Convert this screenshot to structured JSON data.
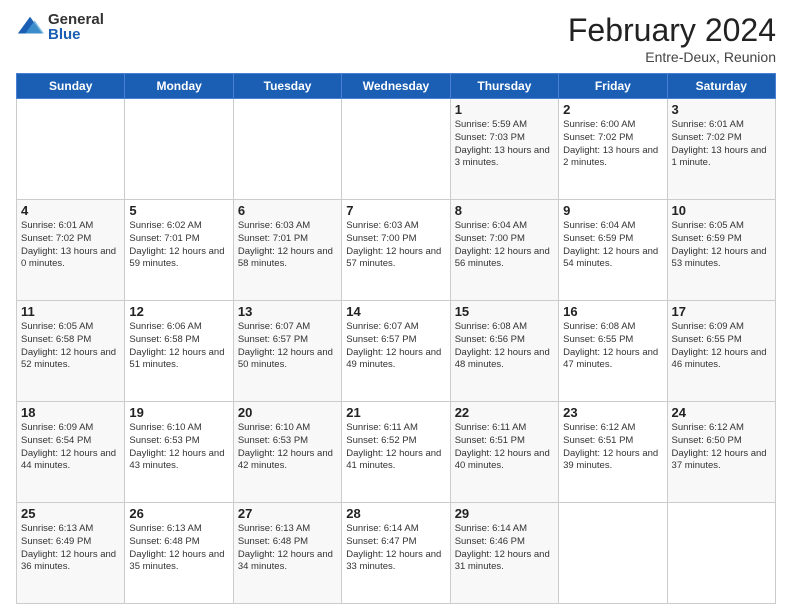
{
  "header": {
    "logo": {
      "general": "General",
      "blue": "Blue"
    },
    "title": "February 2024",
    "subtitle": "Entre-Deux, Reunion"
  },
  "calendar": {
    "days": [
      "Sunday",
      "Monday",
      "Tuesday",
      "Wednesday",
      "Thursday",
      "Friday",
      "Saturday"
    ],
    "weeks": [
      [
        {
          "day": "",
          "sunrise": "",
          "sunset": "",
          "daylight": ""
        },
        {
          "day": "",
          "sunrise": "",
          "sunset": "",
          "daylight": ""
        },
        {
          "day": "",
          "sunrise": "",
          "sunset": "",
          "daylight": ""
        },
        {
          "day": "",
          "sunrise": "",
          "sunset": "",
          "daylight": ""
        },
        {
          "day": "1",
          "sunrise": "Sunrise: 5:59 AM",
          "sunset": "Sunset: 7:03 PM",
          "daylight": "Daylight: 13 hours and 3 minutes."
        },
        {
          "day": "2",
          "sunrise": "Sunrise: 6:00 AM",
          "sunset": "Sunset: 7:02 PM",
          "daylight": "Daylight: 13 hours and 2 minutes."
        },
        {
          "day": "3",
          "sunrise": "Sunrise: 6:01 AM",
          "sunset": "Sunset: 7:02 PM",
          "daylight": "Daylight: 13 hours and 1 minute."
        }
      ],
      [
        {
          "day": "4",
          "sunrise": "Sunrise: 6:01 AM",
          "sunset": "Sunset: 7:02 PM",
          "daylight": "Daylight: 13 hours and 0 minutes."
        },
        {
          "day": "5",
          "sunrise": "Sunrise: 6:02 AM",
          "sunset": "Sunset: 7:01 PM",
          "daylight": "Daylight: 12 hours and 59 minutes."
        },
        {
          "day": "6",
          "sunrise": "Sunrise: 6:03 AM",
          "sunset": "Sunset: 7:01 PM",
          "daylight": "Daylight: 12 hours and 58 minutes."
        },
        {
          "day": "7",
          "sunrise": "Sunrise: 6:03 AM",
          "sunset": "Sunset: 7:00 PM",
          "daylight": "Daylight: 12 hours and 57 minutes."
        },
        {
          "day": "8",
          "sunrise": "Sunrise: 6:04 AM",
          "sunset": "Sunset: 7:00 PM",
          "daylight": "Daylight: 12 hours and 56 minutes."
        },
        {
          "day": "9",
          "sunrise": "Sunrise: 6:04 AM",
          "sunset": "Sunset: 6:59 PM",
          "daylight": "Daylight: 12 hours and 54 minutes."
        },
        {
          "day": "10",
          "sunrise": "Sunrise: 6:05 AM",
          "sunset": "Sunset: 6:59 PM",
          "daylight": "Daylight: 12 hours and 53 minutes."
        }
      ],
      [
        {
          "day": "11",
          "sunrise": "Sunrise: 6:05 AM",
          "sunset": "Sunset: 6:58 PM",
          "daylight": "Daylight: 12 hours and 52 minutes."
        },
        {
          "day": "12",
          "sunrise": "Sunrise: 6:06 AM",
          "sunset": "Sunset: 6:58 PM",
          "daylight": "Daylight: 12 hours and 51 minutes."
        },
        {
          "day": "13",
          "sunrise": "Sunrise: 6:07 AM",
          "sunset": "Sunset: 6:57 PM",
          "daylight": "Daylight: 12 hours and 50 minutes."
        },
        {
          "day": "14",
          "sunrise": "Sunrise: 6:07 AM",
          "sunset": "Sunset: 6:57 PM",
          "daylight": "Daylight: 12 hours and 49 minutes."
        },
        {
          "day": "15",
          "sunrise": "Sunrise: 6:08 AM",
          "sunset": "Sunset: 6:56 PM",
          "daylight": "Daylight: 12 hours and 48 minutes."
        },
        {
          "day": "16",
          "sunrise": "Sunrise: 6:08 AM",
          "sunset": "Sunset: 6:55 PM",
          "daylight": "Daylight: 12 hours and 47 minutes."
        },
        {
          "day": "17",
          "sunrise": "Sunrise: 6:09 AM",
          "sunset": "Sunset: 6:55 PM",
          "daylight": "Daylight: 12 hours and 46 minutes."
        }
      ],
      [
        {
          "day": "18",
          "sunrise": "Sunrise: 6:09 AM",
          "sunset": "Sunset: 6:54 PM",
          "daylight": "Daylight: 12 hours and 44 minutes."
        },
        {
          "day": "19",
          "sunrise": "Sunrise: 6:10 AM",
          "sunset": "Sunset: 6:53 PM",
          "daylight": "Daylight: 12 hours and 43 minutes."
        },
        {
          "day": "20",
          "sunrise": "Sunrise: 6:10 AM",
          "sunset": "Sunset: 6:53 PM",
          "daylight": "Daylight: 12 hours and 42 minutes."
        },
        {
          "day": "21",
          "sunrise": "Sunrise: 6:11 AM",
          "sunset": "Sunset: 6:52 PM",
          "daylight": "Daylight: 12 hours and 41 minutes."
        },
        {
          "day": "22",
          "sunrise": "Sunrise: 6:11 AM",
          "sunset": "Sunset: 6:51 PM",
          "daylight": "Daylight: 12 hours and 40 minutes."
        },
        {
          "day": "23",
          "sunrise": "Sunrise: 6:12 AM",
          "sunset": "Sunset: 6:51 PM",
          "daylight": "Daylight: 12 hours and 39 minutes."
        },
        {
          "day": "24",
          "sunrise": "Sunrise: 6:12 AM",
          "sunset": "Sunset: 6:50 PM",
          "daylight": "Daylight: 12 hours and 37 minutes."
        }
      ],
      [
        {
          "day": "25",
          "sunrise": "Sunrise: 6:13 AM",
          "sunset": "Sunset: 6:49 PM",
          "daylight": "Daylight: 12 hours and 36 minutes."
        },
        {
          "day": "26",
          "sunrise": "Sunrise: 6:13 AM",
          "sunset": "Sunset: 6:48 PM",
          "daylight": "Daylight: 12 hours and 35 minutes."
        },
        {
          "day": "27",
          "sunrise": "Sunrise: 6:13 AM",
          "sunset": "Sunset: 6:48 PM",
          "daylight": "Daylight: 12 hours and 34 minutes."
        },
        {
          "day": "28",
          "sunrise": "Sunrise: 6:14 AM",
          "sunset": "Sunset: 6:47 PM",
          "daylight": "Daylight: 12 hours and 33 minutes."
        },
        {
          "day": "29",
          "sunrise": "Sunrise: 6:14 AM",
          "sunset": "Sunset: 6:46 PM",
          "daylight": "Daylight: 12 hours and 31 minutes."
        },
        {
          "day": "",
          "sunrise": "",
          "sunset": "",
          "daylight": ""
        },
        {
          "day": "",
          "sunrise": "",
          "sunset": "",
          "daylight": ""
        }
      ]
    ]
  }
}
